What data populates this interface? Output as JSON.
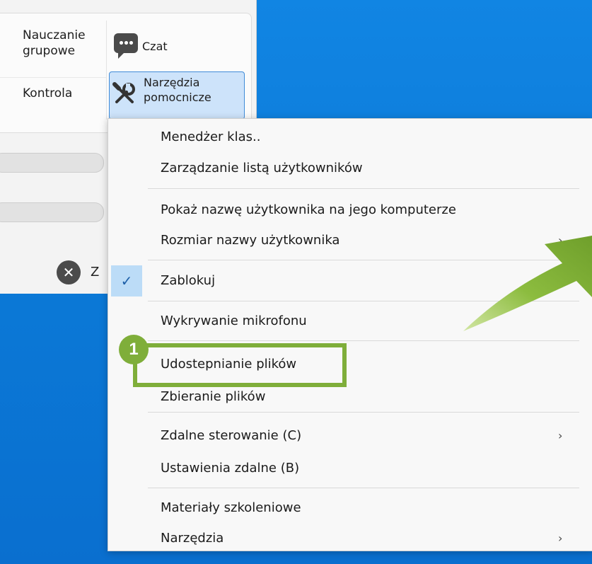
{
  "ribbon": {
    "group_learning": "Nauczanie\ngrupowe",
    "chat": "Czat",
    "control": "Kontrola",
    "tools_line1": "Narzędzia",
    "tools_line2": "pomocnicze"
  },
  "app_window": {
    "truncated_label": "Z"
  },
  "context_menu": {
    "items": [
      {
        "label": "Menedżer klas.."
      },
      {
        "label": "Zarządzanie listą użytkowników"
      },
      {
        "label": "Pokaż nazwę użytkownika na jego komputerze"
      },
      {
        "label": "Rozmiar nazwy użytkownika"
      },
      {
        "label": "Zablokuj",
        "checked": true
      },
      {
        "label": "Wykrywanie mikrofonu"
      },
      {
        "label": "Udostepnianie plików"
      },
      {
        "label": "Zbieranie plików"
      },
      {
        "label": "Zdalne sterowanie (C)"
      },
      {
        "label": "Ustawienia zdalne (B)"
      },
      {
        "label": "Materiały szkoleniowe"
      },
      {
        "label": "Narzędzia"
      }
    ],
    "submenu_chevron": "›",
    "check_glyph": "✓"
  },
  "annotation": {
    "badge_number": "1",
    "highlight_color": "#7fae3a",
    "arrow_color": "#7fae3a"
  }
}
